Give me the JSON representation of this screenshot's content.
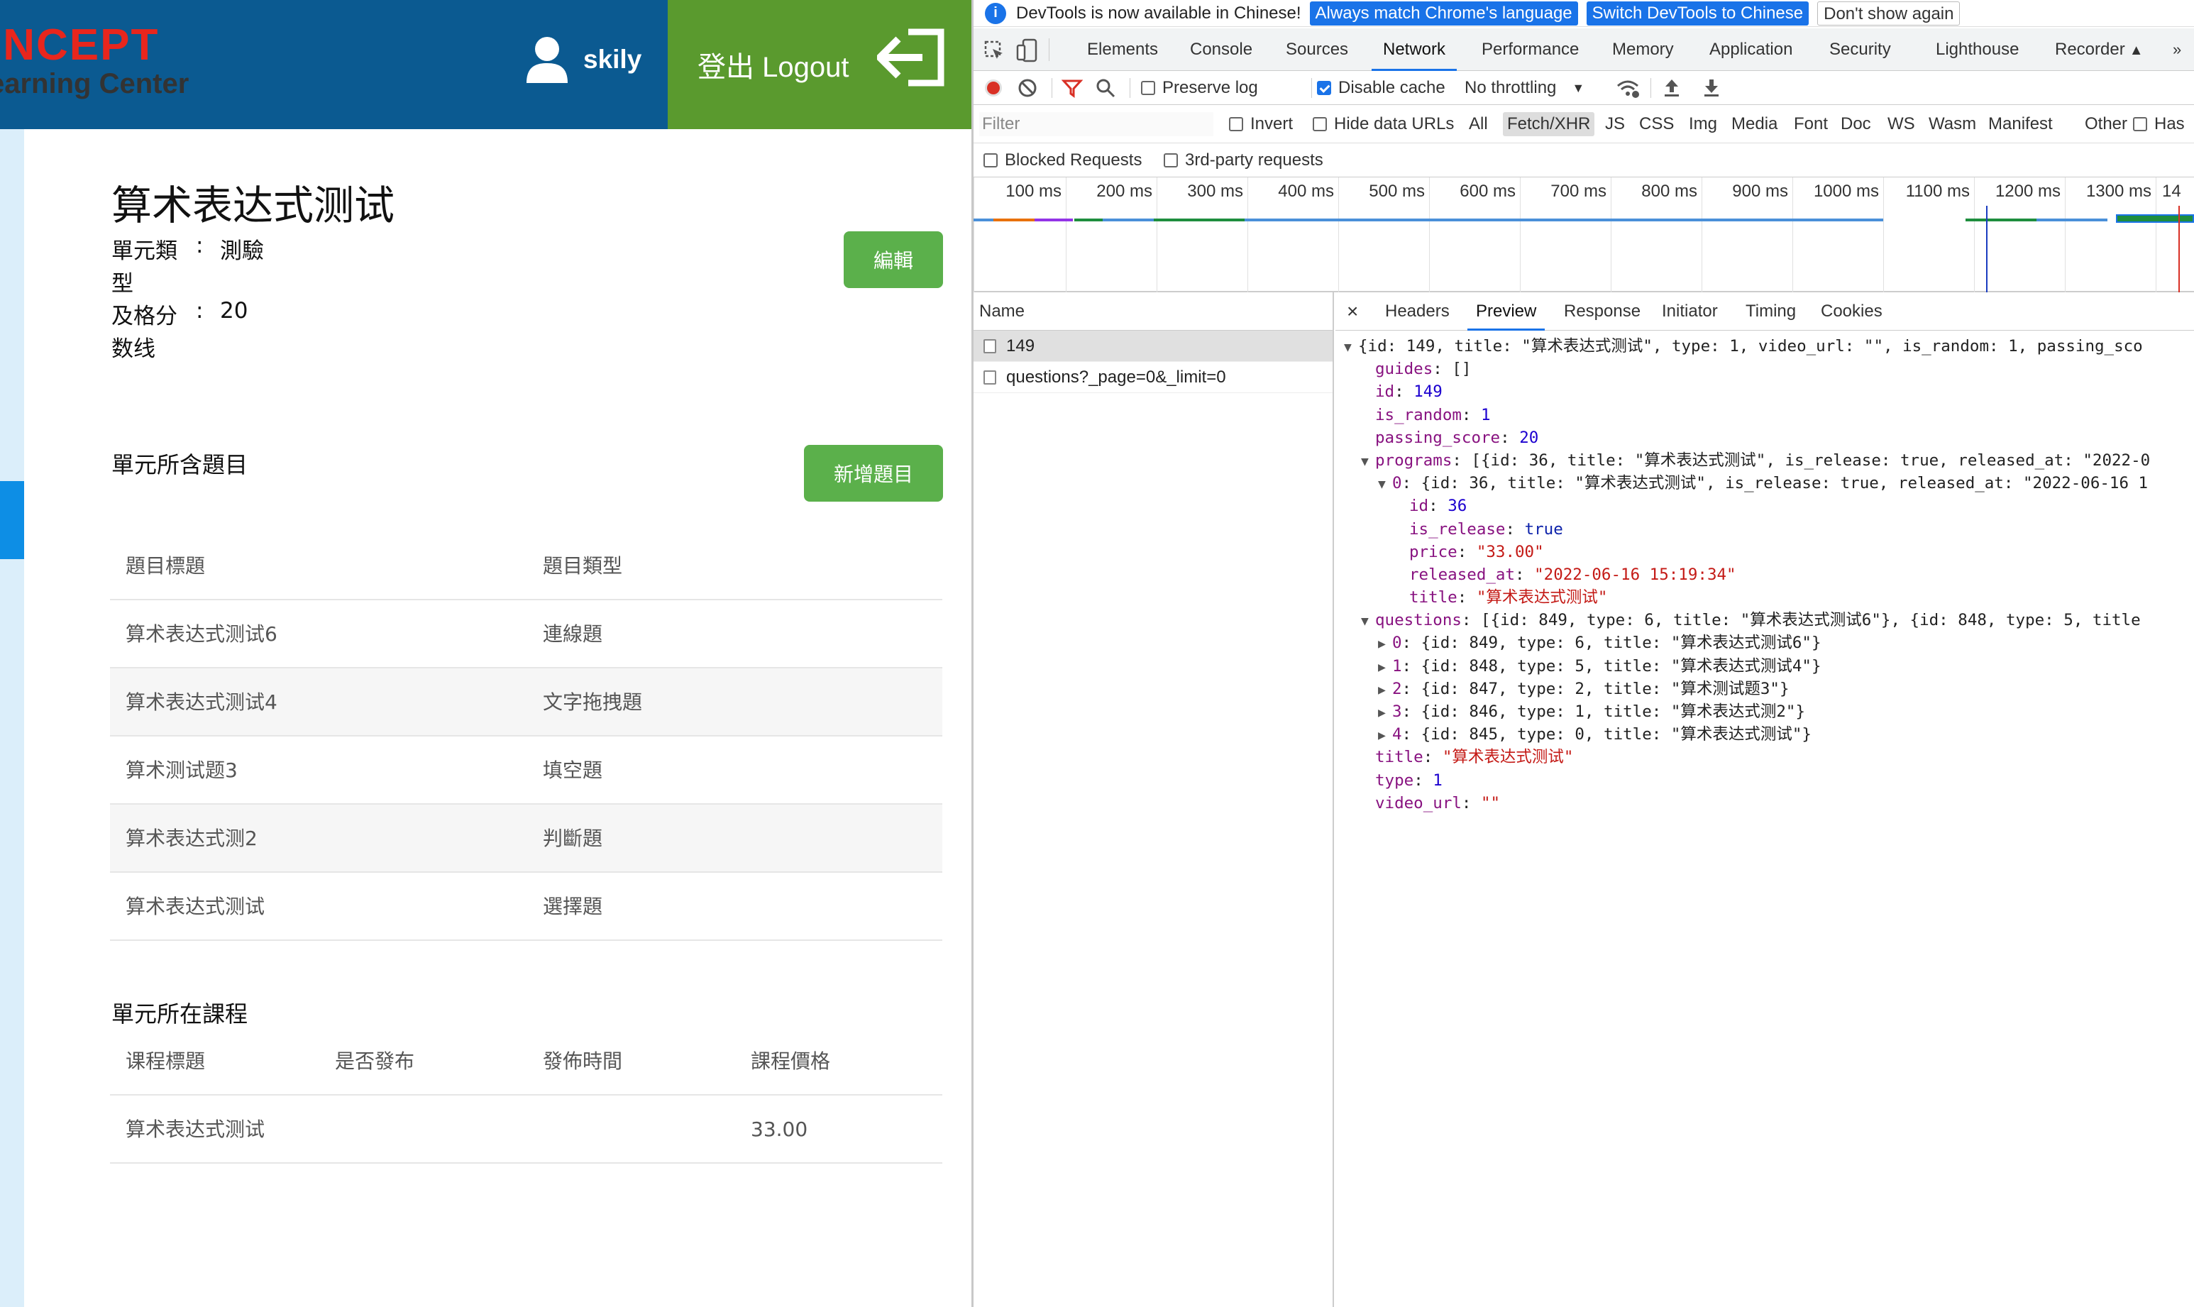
{
  "app": {
    "logo": {
      "line1": "ONCEPT",
      "line2": "earning Center"
    },
    "user": {
      "name": "skily"
    },
    "logout_label": "登出 Logout",
    "unit": {
      "title": "算术表达式测试",
      "type_label": "單元類",
      "type_value": "測驗",
      "type_label_wrap": "型",
      "pass_label": "及格分",
      "pass_value": "20",
      "extra": "数线",
      "sep": ":"
    },
    "edit_button": "編輯",
    "questions_section": {
      "title": "單元所含題目",
      "add_button": "新增題目",
      "headers": [
        "題目標題",
        "題目類型"
      ],
      "rows": [
        [
          "算术表达式测试6",
          "連線題"
        ],
        [
          "算术表达式测试4",
          "文字拖拽題"
        ],
        [
          "算术测试题3",
          "填空題"
        ],
        [
          "算术表达式测2",
          "判斷題"
        ],
        [
          "算术表达式测试",
          "選擇題"
        ]
      ]
    },
    "courses_section": {
      "title": "單元所在課程",
      "headers": [
        "课程標題",
        "是否發布",
        "發佈時間",
        "課程價格"
      ],
      "rows": [
        [
          "算术表达式测试",
          "",
          "",
          "33.00"
        ]
      ]
    }
  },
  "devtools": {
    "infobar": {
      "message": "DevTools is now available in Chinese!",
      "buttons": [
        "Always match Chrome's language",
        "Switch DevTools to Chinese",
        "Don't show again"
      ]
    },
    "tabs": [
      "Elements",
      "Console",
      "Sources",
      "Network",
      "Performance",
      "Memory",
      "Application",
      "Security",
      "Lighthouse",
      "Recorder"
    ],
    "active_tab": "Network",
    "toolbar": {
      "preserve_log": "Preserve log",
      "disable_cache": "Disable cache",
      "throttling": "No throttling"
    },
    "filter": {
      "placeholder": "Filter",
      "invert": "Invert",
      "hide_data_urls": "Hide data URLs",
      "types": [
        "All",
        "Fetch/XHR",
        "JS",
        "CSS",
        "Img",
        "Media",
        "Font",
        "Doc",
        "WS",
        "Wasm",
        "Manifest",
        "Other"
      ],
      "has_blocked": "Has",
      "blocked_requests": "Blocked Requests",
      "third_party": "3rd-party requests"
    },
    "timeline_ticks": [
      "100 ms",
      "200 ms",
      "300 ms",
      "400 ms",
      "500 ms",
      "600 ms",
      "700 ms",
      "800 ms",
      "900 ms",
      "1000 ms",
      "1100 ms",
      "1200 ms",
      "1300 ms",
      "14"
    ],
    "request_list": {
      "header": "Name",
      "rows": [
        "149",
        "questions?_page=0&_limit=0"
      ]
    },
    "detail_tabs": [
      "Headers",
      "Preview",
      "Response",
      "Initiator",
      "Timing",
      "Cookies"
    ],
    "close_glyph": "×",
    "json": {
      "summary": "{id: 149, title: \"算术表达式测试\", type: 1, video_url: \"\", is_random: 1, passing_sco",
      "guides": "[]",
      "id": "149",
      "is_random": "1",
      "passing_score": "20",
      "programs_summary": "[{id: 36, title: \"算术表达式测试\", is_release: true, released_at: \"2022-0",
      "program0_summary": "{id: 36, title: \"算术表达式测试\", is_release: true, released_at: \"2022-06-16 1",
      "program0": {
        "id": "36",
        "is_release": "true",
        "price": "\"33.00\"",
        "released_at": "\"2022-06-16 15:19:34\"",
        "title": "\"算术表达式测试\""
      },
      "questions_summary": "[{id: 849, type: 6, title: \"算术表达式测试6\"}, {id: 848, type: 5, title",
      "questions": [
        "{id: 849, type: 6, title: \"算术表达式测试6\"}",
        "{id: 848, type: 5, title: \"算术表达式测试4\"}",
        "{id: 847, type: 2, title: \"算术测试题3\"}",
        "{id: 846, type: 1, title: \"算术表达式测2\"}",
        "{id: 845, type: 0, title: \"算术表达式测试\"}"
      ],
      "title": "\"算术表达式测试\"",
      "type": "1",
      "video_url": "\"\""
    }
  }
}
